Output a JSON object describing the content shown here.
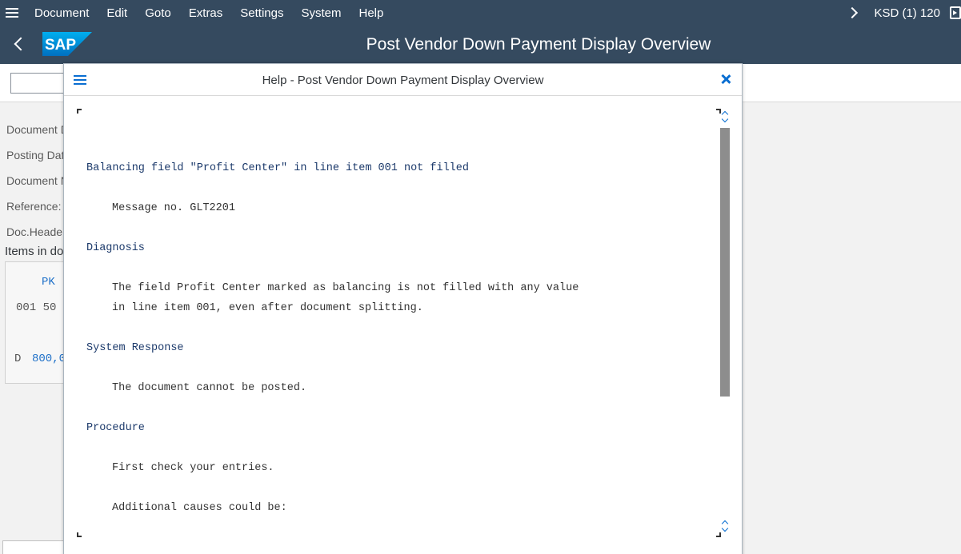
{
  "menubar": {
    "items": [
      "Document",
      "Edit",
      "Goto",
      "Extras",
      "Settings",
      "System",
      "Help"
    ],
    "system_info": "KSD (1) 120"
  },
  "titlebar": {
    "logo_text": "SAP",
    "title": "Post Vendor Down Payment Display Overview"
  },
  "form": {
    "labels": [
      "Document D",
      "Posting Dat",
      "Document N",
      "Reference:",
      "Doc.Heade"
    ],
    "items_title": "Items in do",
    "table_header": "PK",
    "row_line": "001 50",
    "amount_prefix": "D",
    "amount": "800,0"
  },
  "dialog": {
    "title": "Help - Post Vendor Down Payment Display Overview",
    "lines": [
      {
        "kind": "head",
        "text": "Balancing field \"Profit Center\" in line item 001 not filled"
      },
      {
        "kind": "body",
        "text": "Message no. GLT2201"
      },
      {
        "kind": "head",
        "text": "Diagnosis"
      },
      {
        "kind": "body",
        "text": "The field Profit Center marked as balancing is not filled with any value"
      },
      {
        "kind": "body",
        "text": "in line item 001, even after document splitting."
      },
      {
        "kind": "head",
        "text": "System Response"
      },
      {
        "kind": "body",
        "text": "The document cannot be posted."
      },
      {
        "kind": "head",
        "text": "Procedure"
      },
      {
        "kind": "body",
        "text": "First check your entries."
      },
      {
        "kind": "body",
        "text": "Additional causes could be:"
      }
    ]
  },
  "colors": {
    "shell_bar": "#354a5f",
    "accent": "#0a6ed1",
    "help_heading": "#1c3a6b"
  }
}
